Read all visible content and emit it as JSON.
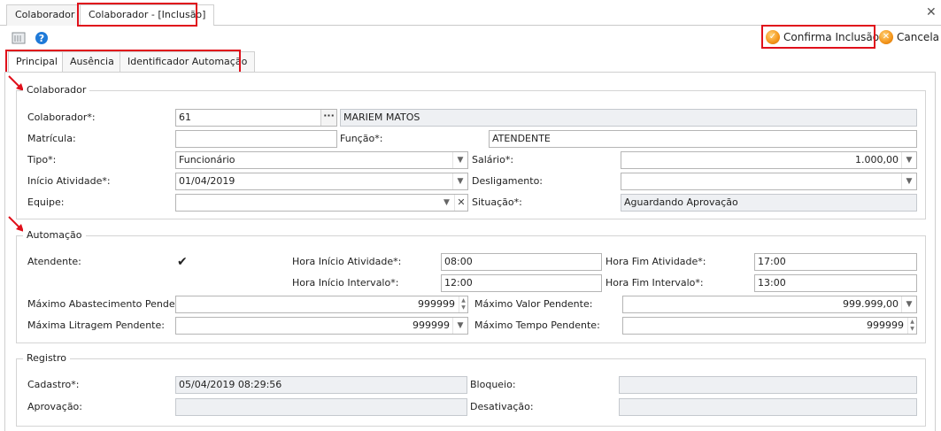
{
  "window": {
    "tabs": [
      {
        "label": "Colaborador"
      },
      {
        "label": "Colaborador - [Inclusão]"
      }
    ]
  },
  "toolbar": {
    "confirm_label": "Confirma Inclusão",
    "cancel_label": "Cancela"
  },
  "inner_tabs": [
    {
      "label": "Principal"
    },
    {
      "label": "Ausência"
    },
    {
      "label": "Identificador Automação"
    }
  ],
  "colaborador_group": {
    "title": "Colaborador",
    "colaborador_label": "Colaborador*:",
    "colaborador_code": "61",
    "colaborador_name": "MARIEM MATOS",
    "matricula_label": "Matrícula:",
    "matricula_value": "",
    "funcao_label": "Função*:",
    "funcao_value": "ATENDENTE",
    "tipo_label": "Tipo*:",
    "tipo_value": "Funcionário",
    "salario_label": "Salário*:",
    "salario_value": "1.000,00",
    "inicio_label": "Início Atividade*:",
    "inicio_value": "01/04/2019",
    "desligamento_label": "Desligamento:",
    "desligamento_value": "",
    "equipe_label": "Equipe:",
    "equipe_value": "",
    "situacao_label": "Situação*:",
    "situacao_value": "Aguardando Aprovação"
  },
  "automacao_group": {
    "title": "Automação",
    "atendente_label": "Atendente:",
    "atendente_checked": true,
    "hora_inicio_atividade_label": "Hora Início Atividade*:",
    "hora_inicio_atividade_value": "08:00",
    "hora_fim_atividade_label": "Hora Fim Atividade*:",
    "hora_fim_atividade_value": "17:00",
    "hora_inicio_intervalo_label": "Hora Início Intervalo*:",
    "hora_inicio_intervalo_value": "12:00",
    "hora_fim_intervalo_label": "Hora Fim Intervalo*:",
    "hora_fim_intervalo_value": "13:00",
    "max_abastecimento_label": "Máximo Abastecimento Pendente:",
    "max_abastecimento_value": "999999",
    "max_valor_label": "Máximo Valor Pendente:",
    "max_valor_value": "999.999,00",
    "max_litragem_label": "Máxima Litragem Pendente:",
    "max_litragem_value": "999999",
    "max_tempo_label": "Máximo Tempo Pendente:",
    "max_tempo_value": "999999"
  },
  "registro_group": {
    "title": "Registro",
    "cadastro_label": "Cadastro*:",
    "cadastro_value": "05/04/2019 08:29:56",
    "bloqueio_label": "Bloqueio:",
    "bloqueio_value": "",
    "aprovacao_label": "Aprovação:",
    "aprovacao_value": "",
    "desativacao_label": "Desativação:",
    "desativacao_value": ""
  },
  "colors": {
    "highlight": "#e0101b",
    "readonly_bg": "#eef0f3"
  }
}
